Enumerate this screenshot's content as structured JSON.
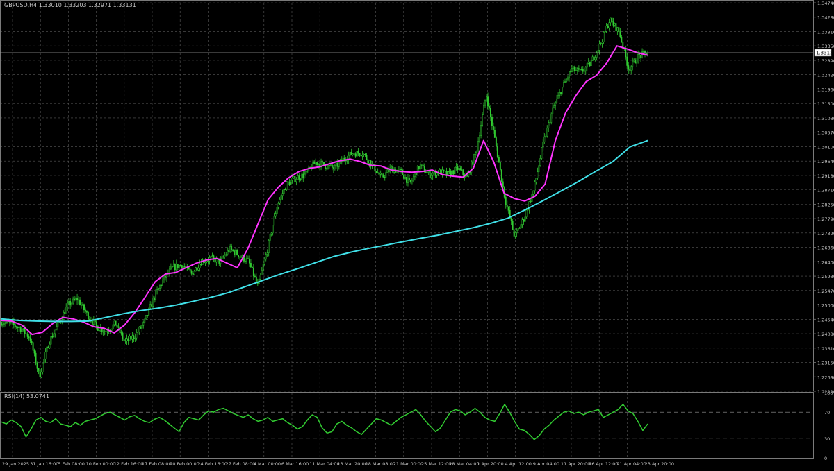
{
  "window": {
    "symbol_header": "GBPUSD,H4  1.33010 1.33203 1.32971 1.33131",
    "current_price_label": "1.33131"
  },
  "colors": {
    "background": "#000000",
    "grid": "#5a5a5a",
    "candle": "#32cd32",
    "ma_fast": "#ff33ff",
    "ma_slow": "#40e0e8",
    "rsi_line": "#32cd32",
    "text": "#c8c8c8",
    "axis": "#7a7a7a"
  },
  "chart_data": [
    {
      "type": "line",
      "title": "GBPUSD,H4  1.33010 1.33203 1.32971 1.33131",
      "ylim": [
        1.2222,
        1.3474
      ],
      "y_ticks": [
        "1.34740",
        "1.34280",
        "1.33810",
        "1.33350",
        "1.32890",
        "1.32420",
        "1.31960",
        "1.31500",
        "1.31030",
        "1.30570",
        "1.30100",
        "1.29640",
        "1.29180",
        "1.28710",
        "1.28250",
        "1.27790",
        "1.27320",
        "1.26860",
        "1.26400",
        "1.25930",
        "1.25470",
        "1.25000",
        "1.24540",
        "1.24080",
        "1.23610",
        "1.23150",
        "1.22690",
        "1.22220"
      ],
      "x_ticks": [
        "29 Jan 2025",
        "31 Jan 16:00",
        "5 Feb 08:00",
        "10 Feb 00:00",
        "12 Feb 16:00",
        "17 Feb 08:00",
        "20 Feb 00:00",
        "24 Feb 16:00",
        "27 Feb 08:00",
        "4 Mar 00:00",
        "6 Mar 16:00",
        "11 Mar 04:00",
        "13 Mar 20:00",
        "18 Mar 08:00",
        "21 Mar 00:00",
        "25 Mar 12:00",
        "28 Mar 04:00",
        "1 Apr 20:00",
        "4 Apr 12:00",
        "9 Apr 04:00",
        "11 Apr 20:00",
        "16 Apr 12:00",
        "21 Apr 04:00",
        "23 Apr 20:00"
      ],
      "last_price": 1.33131,
      "price_path": [
        1.2445,
        1.244,
        1.2425,
        1.2395,
        1.227,
        1.238,
        1.244,
        1.25,
        1.252,
        1.247,
        1.243,
        1.2415,
        1.244,
        1.238,
        1.24,
        1.244,
        1.252,
        1.258,
        1.262,
        1.263,
        1.26,
        1.264,
        1.265,
        1.264,
        1.268,
        1.266,
        1.264,
        1.256,
        1.268,
        1.282,
        1.289,
        1.291,
        1.292,
        1.296,
        1.295,
        1.294,
        1.297,
        1.299,
        1.299,
        1.295,
        1.291,
        1.294,
        1.293,
        1.289,
        1.295,
        1.292,
        1.293,
        1.292,
        1.294,
        1.291,
        1.3,
        1.318,
        1.302,
        1.284,
        1.272,
        1.278,
        1.287,
        1.302,
        1.313,
        1.32,
        1.326,
        1.325,
        1.328,
        1.334,
        1.342,
        1.338,
        1.326,
        1.33,
        1.3313
      ],
      "series": [
        {
          "name": "",
          "kind": "ma_fast",
          "values": [
            1.245,
            1.2448,
            1.2435,
            1.2405,
            1.2412,
            1.244,
            1.246,
            1.2455,
            1.2445,
            1.243,
            1.2425,
            1.241,
            1.2435,
            1.2475,
            1.2525,
            1.2575,
            1.26,
            1.2605,
            1.262,
            1.2635,
            1.2645,
            1.265,
            1.2635,
            1.262,
            1.268,
            1.276,
            1.284,
            1.288,
            1.291,
            1.293,
            1.294,
            1.2945,
            1.2955,
            1.2965,
            1.297,
            1.2962,
            1.295,
            1.2948,
            1.2935,
            1.293,
            1.2928,
            1.293,
            1.2935,
            1.292,
            1.2915,
            1.2912,
            1.294,
            1.303,
            1.296,
            1.286,
            1.2843,
            1.2835,
            1.285,
            1.289,
            1.303,
            1.312,
            1.3175,
            1.322,
            1.324,
            1.328,
            1.3335,
            1.3325,
            1.3313,
            1.3305
          ]
        },
        {
          "name": "",
          "kind": "ma_slow",
          "values": [
            1.2455,
            1.245,
            1.2448,
            1.2447,
            1.2447,
            1.2448,
            1.246,
            1.2472,
            1.2482,
            1.249,
            1.25,
            1.2512,
            1.2525,
            1.254,
            1.256,
            1.258,
            1.26,
            1.2618,
            1.2637,
            1.2656,
            1.267,
            1.2682,
            1.2693,
            1.2704,
            1.2715,
            1.2725,
            1.2737,
            1.2749,
            1.2763,
            1.278,
            1.2807,
            1.2836,
            1.2866,
            1.2897,
            1.293,
            1.2962,
            1.301,
            1.303
          ]
        }
      ]
    },
    {
      "type": "line",
      "title": "RSI(14) 53.0741",
      "ylim": [
        0,
        100
      ],
      "y_ticks": [
        "100",
        "70",
        "30",
        "0"
      ],
      "levels": [
        70,
        30
      ],
      "series": [
        {
          "name": "RSI(14)",
          "values": [
            55,
            52,
            58,
            54,
            48,
            32,
            44,
            58,
            62,
            56,
            54,
            60,
            52,
            50,
            48,
            54,
            50,
            56,
            58,
            60,
            64,
            68,
            70,
            66,
            62,
            58,
            63,
            65,
            60,
            56,
            54,
            59,
            62,
            58,
            52,
            46,
            40,
            54,
            62,
            60,
            58,
            66,
            72,
            70,
            74,
            76,
            72,
            68,
            65,
            62,
            66,
            60,
            56,
            58,
            62,
            56,
            58,
            60,
            54,
            50,
            44,
            48,
            58,
            66,
            62,
            46,
            38,
            40,
            52,
            56,
            50,
            46,
            40,
            36,
            44,
            52,
            60,
            58,
            54,
            50,
            56,
            62,
            66,
            70,
            74,
            66,
            56,
            48,
            40,
            46,
            58,
            70,
            74,
            72,
            66,
            70,
            76,
            70,
            62,
            58,
            56,
            68,
            82,
            70,
            56,
            44,
            42,
            36,
            28,
            34,
            44,
            50,
            58,
            64,
            70,
            72,
            68,
            70,
            66,
            70,
            72,
            74,
            62,
            66,
            70,
            74,
            82,
            72,
            68,
            56,
            42,
            52
          ]
        }
      ]
    }
  ]
}
